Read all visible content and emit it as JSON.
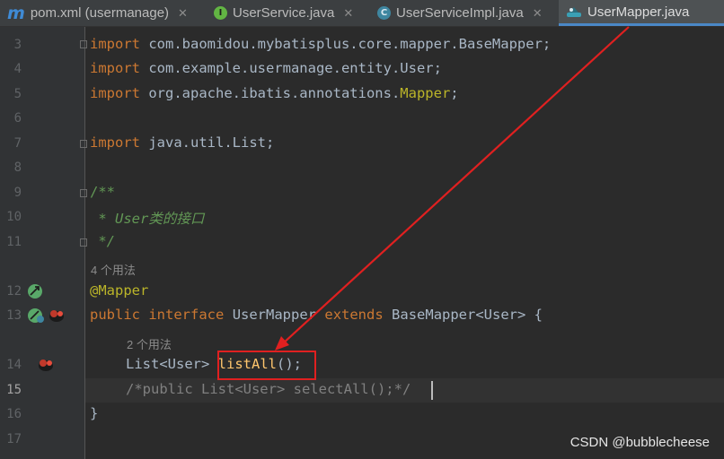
{
  "tabs": [
    {
      "label": "pom.xml (usermanage)",
      "icon": "maven-icon"
    },
    {
      "label": "UserService.java",
      "icon": "interface-icon"
    },
    {
      "label": "UserServiceImpl.java",
      "icon": "class-icon"
    },
    {
      "label": "UserMapper.java",
      "icon": "mapper-file-icon",
      "active": true
    }
  ],
  "line_numbers": [
    "3",
    "4",
    "5",
    "6",
    "7",
    "8",
    "9",
    "10",
    "11",
    "12",
    "13",
    "14",
    "15",
    "16",
    "17"
  ],
  "code": {
    "l3": {
      "kw": "import",
      "rest": " com.baomidou.mybatisplus.core.mapper.BaseMapper;"
    },
    "l4": {
      "kw": "import",
      "rest": " com.example.usermanage.entity.User;"
    },
    "l5": {
      "kw": "import",
      "pkg": " org.apache.ibatis.annotations.",
      "ann": "Mapper",
      "semi": ";"
    },
    "l7": {
      "kw": "import",
      "rest": " java.util.List;"
    },
    "l9": "/**",
    "l10": " * User类的接口",
    "l11": " */",
    "hint1": "4 个用法",
    "l12": "@Mapper",
    "l13": {
      "kw1": "public",
      "kw2": "interface",
      "name": "UserMapper",
      "kw3": "extends",
      "rest": "BaseMapper<User> {"
    },
    "hint2": "2 个用法",
    "l14": {
      "type": "List<User>",
      "method": "listAll",
      "rest": "();"
    },
    "l15": "/*public List<User> selectAll();*/",
    "l16": "}"
  },
  "annotation": {
    "box_color": "#e02020",
    "arrow_color": "#e02020"
  },
  "watermark": "CSDN @bubblecheese",
  "colors": {
    "keyword": "#cc7832",
    "comment": "#808080",
    "doc": "#629755",
    "annotation": "#bbb529",
    "method": "#ffc66d",
    "text": "#a9b7c6"
  }
}
